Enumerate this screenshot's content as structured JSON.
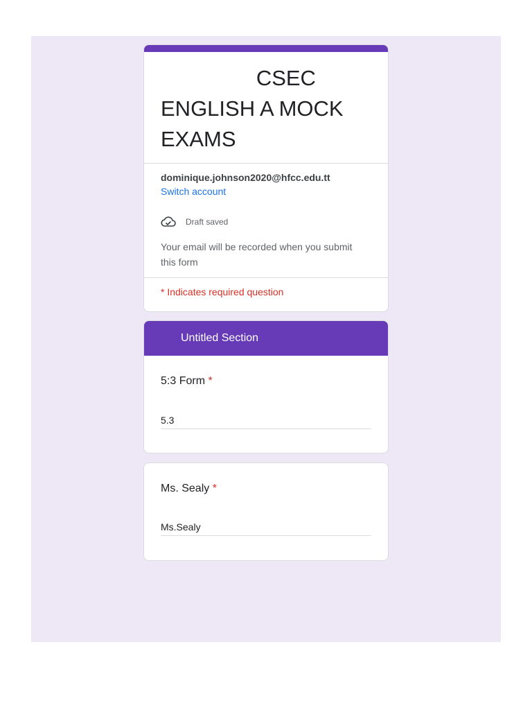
{
  "form": {
    "title": "                CSEC\nENGLISH A MOCK EXAMS",
    "accent_color": "#673ab7",
    "background_color": "#ede7f6"
  },
  "account": {
    "email": "dominique.johnson2020@hfcc.edu.tt",
    "switch_label": "Switch account"
  },
  "draft": {
    "icon": "cloud-check-icon",
    "status": "Draft saved"
  },
  "notes": {
    "email_recorded": "Your email will be recorded when you submit this form",
    "required": "* Indicates required question"
  },
  "section": {
    "title": "Untitled Section"
  },
  "questions": [
    {
      "label": "5:3 Form",
      "required_mark": "*",
      "value": "5.3"
    },
    {
      "label": "Ms. Sealy",
      "required_mark": "*",
      "value": "Ms.Sealy"
    }
  ]
}
